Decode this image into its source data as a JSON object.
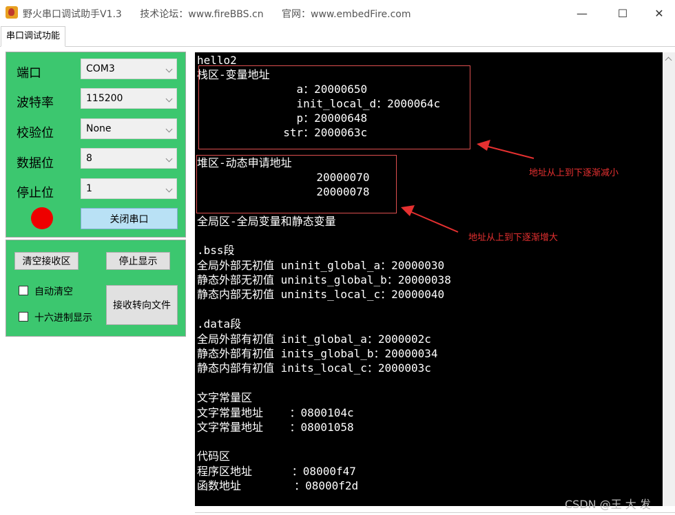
{
  "window": {
    "title": "野火串口调试助手V1.3",
    "forum": "技术论坛：www.fireBBS.cn",
    "website": "官网：www.embedFire.com",
    "minimize": "—",
    "maximize": "☐",
    "close": "✕"
  },
  "tabs": [
    "串口调试功能"
  ],
  "serial_settings": {
    "port_label": "端口",
    "port_value": "COM3",
    "baud_label": "波特率",
    "baud_value": "115200",
    "parity_label": "校验位",
    "parity_value": "None",
    "databits_label": "数据位",
    "databits_value": "8",
    "stopbits_label": "停止位",
    "stopbits_value": "1",
    "status_color": "#ee0000",
    "toggle_button": "关闭串口"
  },
  "receive_controls": {
    "clear_button": "清空接收区",
    "stop_display_button": "停止显示",
    "auto_clear_label": "自动清空",
    "hex_display_label": "十六进制显示",
    "to_file_button": "接收转向文件"
  },
  "terminal_lines": [
    "hello2",
    "栈区-变量地址",
    "               a：20000650",
    "               init_local_d：2000064c",
    "               p：20000648",
    "             str：2000063c",
    "",
    "堆区-动态申请地址",
    "                  20000070",
    "                  20000078",
    "全局区-全局变量和静态变量",
    "",
    ".bss段",
    "全局外部无初值 uninit_global_a：20000030",
    "静态外部无初值 uninits_global_b：20000038",
    "静态内部无初值 uninits_local_c：20000040",
    "",
    ".data段",
    "全局外部有初值 init_global_a：2000002c",
    "静态外部有初值 inits_global_b：20000034",
    "静态内部有初值 inits_local_c：2000003c",
    "",
    "文字常量区",
    "文字常量地址    ：0800104c",
    "文字常量地址    ：08001058",
    "",
    "代码区",
    "程序区地址      ：08000f47",
    "函数地址        ：08000f2d"
  ],
  "annotations": {
    "stack_note": "地址从上到下逐渐减小",
    "heap_note": "地址从上到下逐渐增大"
  },
  "watermark": "CSDN @王 大 发"
}
